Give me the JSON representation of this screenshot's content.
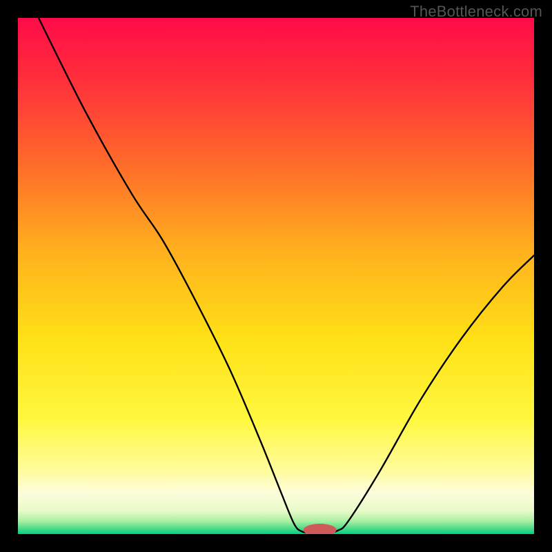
{
  "watermark": "TheBottleneck.com",
  "gradient": {
    "stops": [
      {
        "offset": 0.0,
        "color": "#ff0b48"
      },
      {
        "offset": 0.12,
        "color": "#ff2f3b"
      },
      {
        "offset": 0.28,
        "color": "#ff6a2a"
      },
      {
        "offset": 0.45,
        "color": "#ffb01e"
      },
      {
        "offset": 0.62,
        "color": "#ffe016"
      },
      {
        "offset": 0.78,
        "color": "#fff840"
      },
      {
        "offset": 0.88,
        "color": "#fffca0"
      },
      {
        "offset": 0.92,
        "color": "#fdfddc"
      },
      {
        "offset": 0.955,
        "color": "#e9fbc8"
      },
      {
        "offset": 0.975,
        "color": "#a9f0a3"
      },
      {
        "offset": 0.988,
        "color": "#55dd88"
      },
      {
        "offset": 1.0,
        "color": "#00d084"
      }
    ]
  },
  "chart_data": {
    "type": "line",
    "title": "",
    "xlabel": "",
    "ylabel": "",
    "xlim": [
      0,
      100
    ],
    "ylim": [
      0,
      100
    ],
    "series": [
      {
        "name": "bottleneck-curve",
        "points": [
          {
            "x": 4,
            "y": 100
          },
          {
            "x": 13,
            "y": 82
          },
          {
            "x": 22,
            "y": 66
          },
          {
            "x": 28,
            "y": 57
          },
          {
            "x": 34,
            "y": 46
          },
          {
            "x": 41,
            "y": 32
          },
          {
            "x": 47,
            "y": 18
          },
          {
            "x": 51,
            "y": 8
          },
          {
            "x": 53.5,
            "y": 2
          },
          {
            "x": 55,
            "y": 0.5
          },
          {
            "x": 57,
            "y": 0.3
          },
          {
            "x": 60,
            "y": 0.3
          },
          {
            "x": 62,
            "y": 0.7
          },
          {
            "x": 64,
            "y": 2.5
          },
          {
            "x": 70,
            "y": 12
          },
          {
            "x": 78,
            "y": 26
          },
          {
            "x": 86,
            "y": 38
          },
          {
            "x": 94,
            "y": 48
          },
          {
            "x": 100,
            "y": 54
          }
        ]
      }
    ],
    "marker": {
      "name": "optimal",
      "cx": 58.5,
      "cy": 0.8,
      "rx": 3.2,
      "ry": 1.2,
      "color": "#d05a5a"
    }
  }
}
